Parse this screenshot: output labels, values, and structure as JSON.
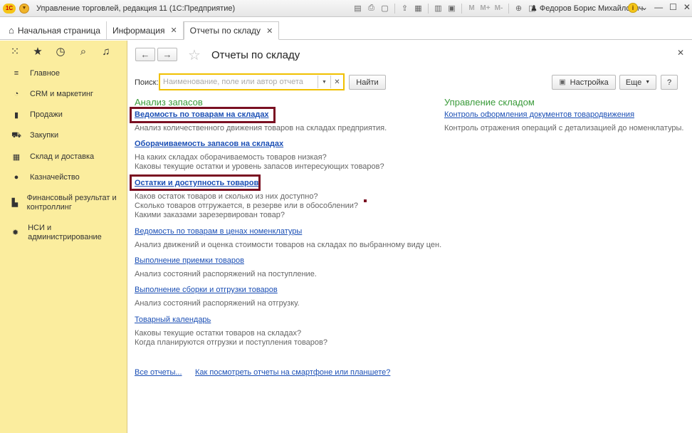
{
  "window": {
    "logo": "1С",
    "title": "Управление торговлей, редакция 11  (1С:Предприятие)",
    "user": "Федоров Борис Михайлович",
    "toolbar_m": [
      "M",
      "M+",
      "M-"
    ]
  },
  "tabs": [
    {
      "label": "Начальная страница"
    },
    {
      "label": "Информация"
    },
    {
      "label": "Отчеты по складу"
    }
  ],
  "sidebar": {
    "items": [
      {
        "label": "Главное",
        "icon": "menu-icon"
      },
      {
        "label": "CRM и маркетинг",
        "icon": "pie-icon"
      },
      {
        "label": "Продажи",
        "icon": "bag-icon"
      },
      {
        "label": "Закупки",
        "icon": "cart-icon"
      },
      {
        "label": "Склад и доставка",
        "icon": "grid-icon"
      },
      {
        "label": "Казначейство",
        "icon": "coin-icon"
      },
      {
        "label": "Финансовый результат и контроллинг",
        "icon": "chart-icon"
      },
      {
        "label": "НСИ и администрирование",
        "icon": "gear-icon"
      }
    ]
  },
  "page": {
    "title": "Отчеты по складу",
    "search_label": "Поиск:",
    "search_placeholder": "Наименование, поле или автор отчета",
    "find_button": "Найти",
    "settings_button": "Настройка",
    "more_button": "Еще",
    "help_button": "?"
  },
  "sections": {
    "left": {
      "title": "Анализ запасов",
      "reports": [
        {
          "name": "Ведомость по товарам на складах",
          "desc": [
            "Анализ количественного движения товаров на складах предприятия."
          ]
        },
        {
          "name": "Оборачиваемость запасов на складах",
          "desc": [
            "На каких складах оборачиваемость товаров низкая?",
            "Каковы текущие остатки и уровень запасов интересующих товаров?"
          ]
        },
        {
          "name": "Остатки и доступность товаров",
          "desc": [
            "Каков остаток товаров и сколько из них доступно?",
            "Сколько товаров отгружается, в резерве или в обособлении?",
            "Какими заказами зарезервирован товар?"
          ]
        },
        {
          "name": "Ведомость по товарам в ценах номенклатуры",
          "desc": [
            "Анализ движений и оценка стоимости товаров на складах по выбранному виду цен."
          ]
        },
        {
          "name": "Выполнение приемки товаров",
          "desc": [
            "Анализ состояний распоряжений на поступление."
          ]
        },
        {
          "name": "Выполнение сборки и отгрузки товаров",
          "desc": [
            "Анализ состояний распоряжений на отгрузку."
          ]
        },
        {
          "name": "Товарный календарь",
          "desc": [
            "Каковы текущие остатки товаров на складах?",
            "Когда планируются отгрузки и поступления товаров?"
          ]
        }
      ]
    },
    "right": {
      "title": "Управление складом",
      "reports": [
        {
          "name": "Контроль оформления документов товародвижения",
          "desc": [
            "Контроль отражения операций с детализацией до номенклатуры."
          ]
        }
      ]
    }
  },
  "footer": {
    "all_reports": "Все отчеты...",
    "mobile_link": "Как посмотреть отчеты на смартфоне или планшете?"
  }
}
